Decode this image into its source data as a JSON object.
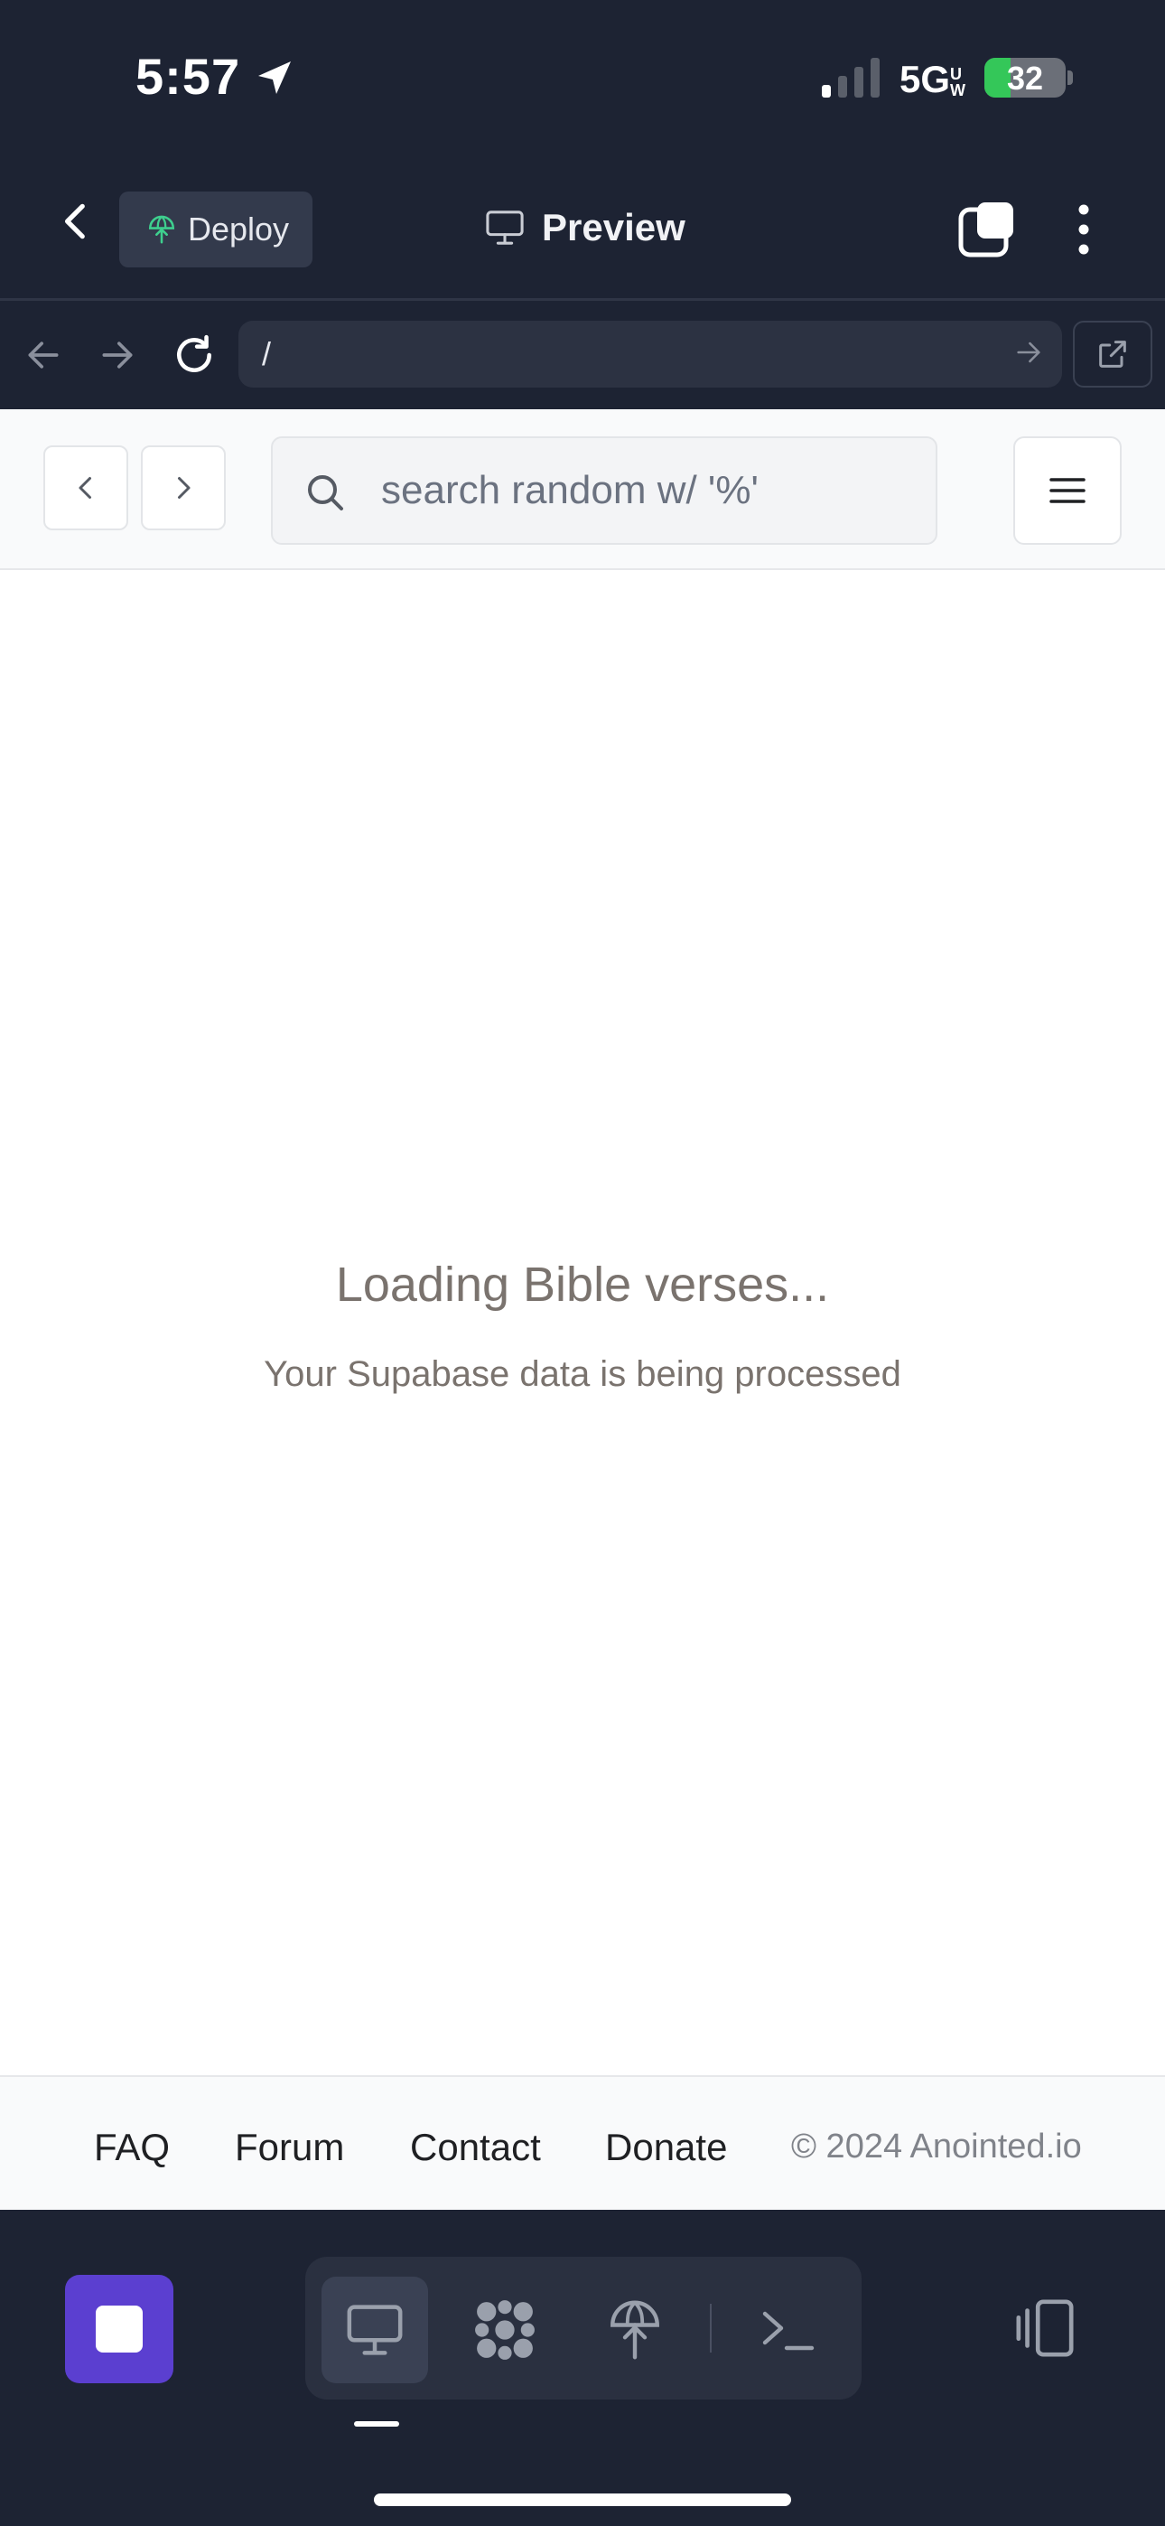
{
  "status_bar": {
    "time": "5:57",
    "network": "5G",
    "network_suffix": "UW",
    "battery_level": "32",
    "battery_fraction": 0.32,
    "battery_charging": true
  },
  "header": {
    "deploy_label": "Deploy",
    "preview_label": "Preview"
  },
  "url_bar": {
    "url": "/"
  },
  "page": {
    "search": {
      "placeholder": "search random w/ '%'"
    },
    "loading_title": "Loading Bible verses...",
    "loading_subtitle": "Your Supabase data is being processed",
    "footer": {
      "links": [
        "FAQ",
        "Forum",
        "Contact",
        "Donate"
      ],
      "copyright": "© 2024 Anointed.io"
    }
  },
  "colors": {
    "chrome_bg": "#1d2333",
    "stop_button": "#5b3fd0",
    "deploy_icon": "#3ecf8e",
    "battery_fill": "#34c759"
  },
  "icons": {
    "location": "location-arrow-icon",
    "deploy": "globe-pin-icon",
    "preview": "monitor-icon",
    "tabs": "tabs-icon",
    "more": "more-vertical-icon",
    "back": "arrow-left-icon",
    "forward": "arrow-right-icon",
    "reload": "reload-icon",
    "open_external": "external-link-icon",
    "search": "search-icon",
    "menu": "hamburger-icon",
    "mode_preview": "monitor-icon",
    "mode_plugins": "cluster-icon",
    "mode_deploy": "globe-pin-icon",
    "mode_terminal": "terminal-icon",
    "split_view": "split-view-icon"
  }
}
